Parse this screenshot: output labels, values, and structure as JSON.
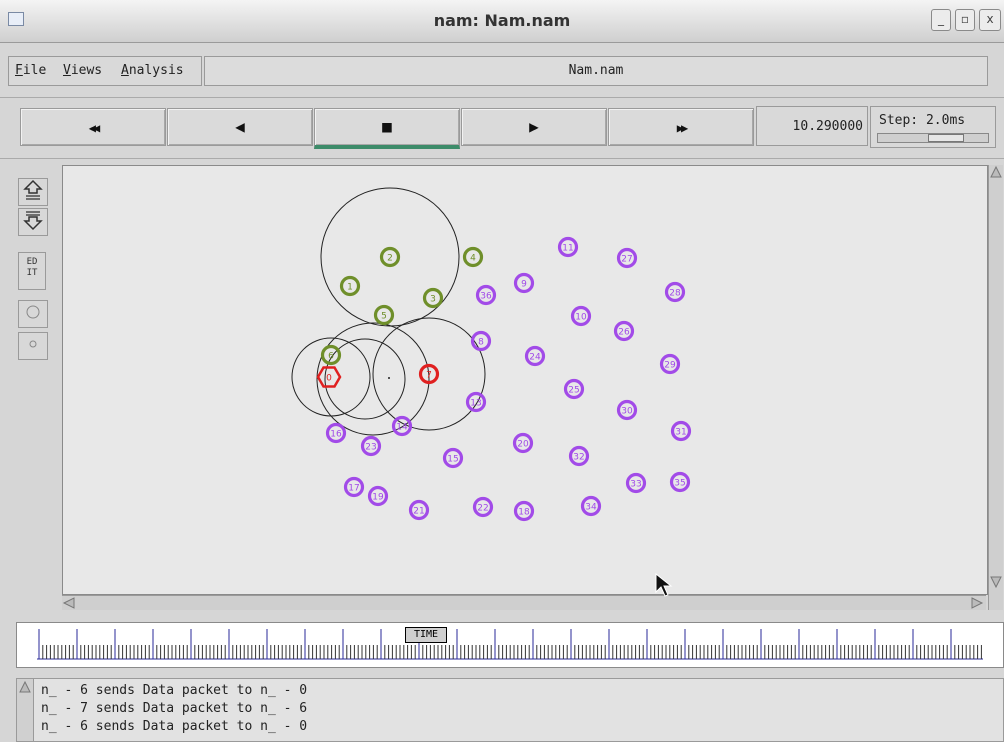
{
  "window": {
    "title": "nam: Nam.nam",
    "min_symbol": "_",
    "max_symbol": "▫",
    "close_symbol": "x"
  },
  "menu": {
    "file": {
      "hot": "F",
      "rest": "ile"
    },
    "views": {
      "hot": "V",
      "rest": "iews"
    },
    "analysis": {
      "hot": "A",
      "rest": "nalysis"
    },
    "file_name": "Nam.nam"
  },
  "controls": {
    "rewind_icon": "◀◀",
    "back_icon": "◀",
    "stop_icon": "■",
    "play_icon": "▶",
    "fastforward_icon": "▶▶",
    "time": "10.290000",
    "step_label": "Step: 2.0ms",
    "active_button": "stop"
  },
  "tools": {
    "zoom_in": "zoom-in-icon",
    "zoom_out": "zoom-out-icon",
    "edit_label": "ED\nIT"
  },
  "colors": {
    "purple": "#a24be8",
    "green": "#6f8f2a",
    "red": "#e02020",
    "range": "#222222"
  },
  "network": {
    "nodes": [
      {
        "id": "0",
        "color": "red",
        "shape": "hexagon"
      },
      {
        "id": "1",
        "color": "green",
        "shape": "circle"
      },
      {
        "id": "2",
        "color": "green",
        "shape": "circle"
      },
      {
        "id": "3",
        "color": "green",
        "shape": "circle"
      },
      {
        "id": "4",
        "color": "green",
        "shape": "circle"
      },
      {
        "id": "5",
        "color": "green",
        "shape": "circle"
      },
      {
        "id": "6",
        "color": "green",
        "shape": "circle"
      },
      {
        "id": "7",
        "color": "red",
        "shape": "circle"
      },
      {
        "id": "8",
        "color": "purple",
        "shape": "circle"
      },
      {
        "id": "9",
        "color": "purple",
        "shape": "circle"
      },
      {
        "id": "10",
        "color": "purple",
        "shape": "circle"
      },
      {
        "id": "11",
        "color": "purple",
        "shape": "circle"
      },
      {
        "id": "13",
        "color": "purple",
        "shape": "circle"
      },
      {
        "id": "14",
        "color": "purple",
        "shape": "circle"
      },
      {
        "id": "15",
        "color": "purple",
        "shape": "circle"
      },
      {
        "id": "16",
        "color": "purple",
        "shape": "circle"
      },
      {
        "id": "17",
        "color": "purple",
        "shape": "circle"
      },
      {
        "id": "18",
        "color": "purple",
        "shape": "circle"
      },
      {
        "id": "19",
        "color": "purple",
        "shape": "circle"
      },
      {
        "id": "20",
        "color": "purple",
        "shape": "circle"
      },
      {
        "id": "21",
        "color": "purple",
        "shape": "circle"
      },
      {
        "id": "22",
        "color": "purple",
        "shape": "circle"
      },
      {
        "id": "23",
        "color": "purple",
        "shape": "circle"
      },
      {
        "id": "24",
        "color": "purple",
        "shape": "circle"
      },
      {
        "id": "25",
        "color": "purple",
        "shape": "circle"
      },
      {
        "id": "26",
        "color": "purple",
        "shape": "circle"
      },
      {
        "id": "27",
        "color": "purple",
        "shape": "circle"
      },
      {
        "id": "28",
        "color": "purple",
        "shape": "circle"
      },
      {
        "id": "29",
        "color": "purple",
        "shape": "circle"
      },
      {
        "id": "30",
        "color": "purple",
        "shape": "circle"
      },
      {
        "id": "31",
        "color": "purple",
        "shape": "circle"
      },
      {
        "id": "32",
        "color": "purple",
        "shape": "circle"
      },
      {
        "id": "33",
        "color": "purple",
        "shape": "circle"
      },
      {
        "id": "34",
        "color": "purple",
        "shape": "circle"
      },
      {
        "id": "35",
        "color": "purple",
        "shape": "circle"
      },
      {
        "id": "36",
        "color": "purple",
        "shape": "circle"
      }
    ]
  },
  "timeline": {
    "label": "TIME"
  },
  "log": {
    "lines": [
      "n_ - 6 sends Data packet to n_ - 0",
      "n_ - 7 sends Data packet to n_ - 6",
      "n_ - 6 sends Data packet to n_ - 0"
    ]
  }
}
